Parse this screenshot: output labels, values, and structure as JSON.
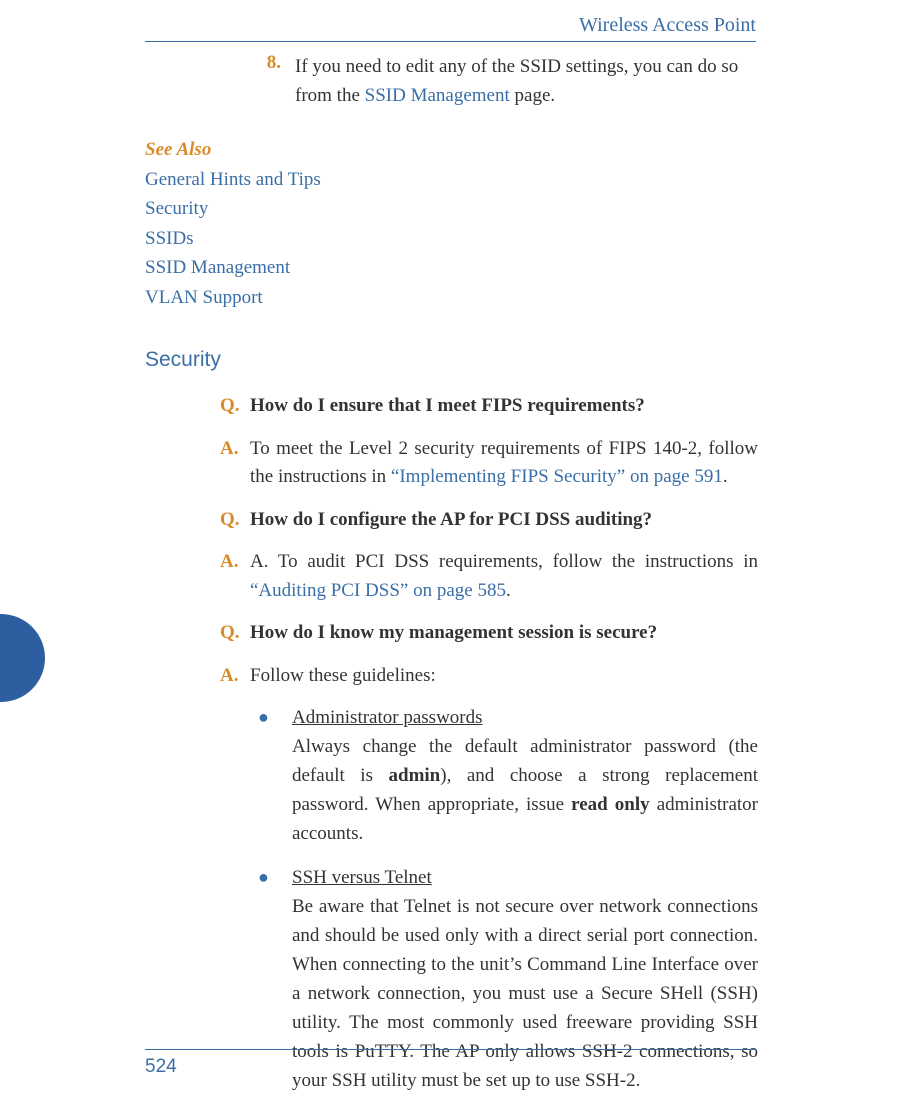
{
  "header": {
    "title": "Wireless Access Point"
  },
  "step8": {
    "marker": "8.",
    "text_before": "If you need to edit any of the SSID settings, you can do so from the ",
    "link": "SSID Management",
    "text_after": " page."
  },
  "see_also": {
    "heading": "See Also",
    "items": [
      "General Hints and Tips",
      "Security",
      "SSIDs",
      "SSID Management",
      "VLAN Support"
    ]
  },
  "section": {
    "heading": "Security"
  },
  "qa": [
    {
      "q_marker": "Q.",
      "q_text": "How do I ensure that I meet FIPS requirements?",
      "a_marker": "A.",
      "a_plain_before": "To meet the Level 2 security requirements of FIPS 140-2, follow the instructions in ",
      "a_link": "“Implementing FIPS Security” on page 591",
      "a_plain_after": "."
    },
    {
      "q_marker": "Q.",
      "q_text": "How do I configure the AP for PCI DSS auditing?",
      "a_marker": "A.",
      "a_plain_before": "A. To audit PCI DSS requirements, follow the instructions in ",
      "a_link": "“Auditing PCI DSS” on page 585",
      "a_plain_after": "."
    },
    {
      "q_marker": "Q.",
      "q_text": "How do I know my management session is secure?",
      "a_marker": "A.",
      "a_plain_before": "Follow these guidelines:",
      "a_link": "",
      "a_plain_after": ""
    }
  ],
  "bullets": [
    {
      "title": "Administrator passwords",
      "body_before": "Always change the default administrator password (the default is ",
      "bold1": "admin",
      "body_mid": "), and choose a strong replacement password. When appropriate, issue ",
      "bold2": "read only",
      "body_after": " administrator accounts."
    },
    {
      "title": "SSH versus Telnet",
      "body_before": "Be aware that Telnet is not secure over network connections and should be used only with a direct serial port connection. When connecting to the unit’s Command Line Interface over a network connection, you must use a Secure SHell (SSH) utility. The most commonly used freeware providing SSH tools is PuTTY. The AP only allows SSH-2 connections, so your SSH utility must be set up to use SSH-2.",
      "bold1": "",
      "body_mid": "",
      "bold2": "",
      "body_after": ""
    }
  ],
  "footer": {
    "page_number": "524"
  },
  "colors": {
    "accent_blue": "#3a6ea7",
    "accent_orange": "#d88b2a",
    "tab_blue": "#2d5fa0"
  }
}
